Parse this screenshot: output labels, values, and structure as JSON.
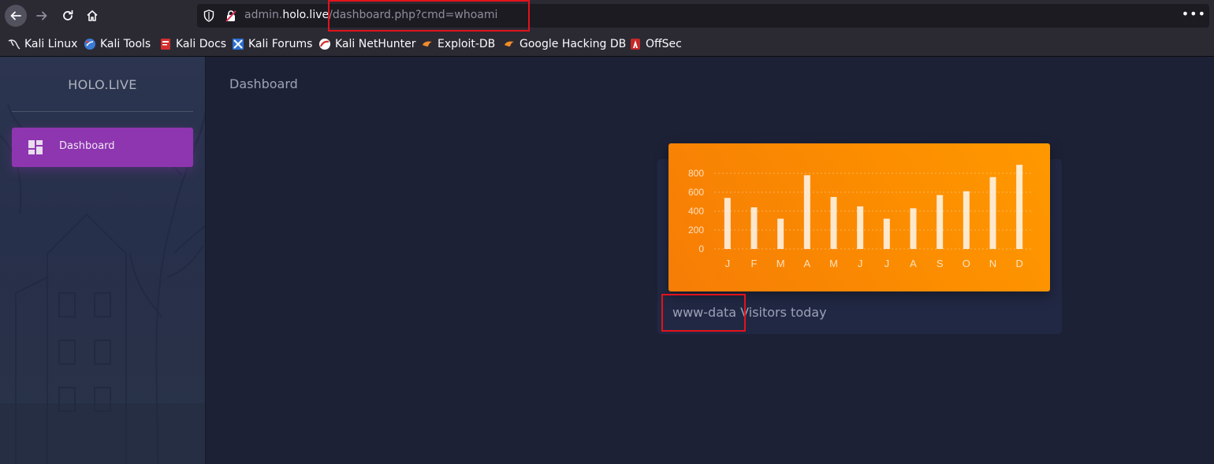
{
  "browser": {
    "url": {
      "scheme_prefix": "admin.",
      "host": "holo.live",
      "path": "/dashboard.php?cmd=whoami"
    },
    "menu_glyph": "•••",
    "bookmarks": [
      {
        "label": "Kali Linux",
        "icon": "kali-dragon-icon"
      },
      {
        "label": "Kali Tools",
        "icon": "kali-tools-icon"
      },
      {
        "label": "Kali Docs",
        "icon": "kali-docs-icon"
      },
      {
        "label": "Kali Forums",
        "icon": "kali-forums-icon"
      },
      {
        "label": "Kali NetHunter",
        "icon": "nethunter-icon"
      },
      {
        "label": "Exploit-DB",
        "icon": "exploit-db-icon"
      },
      {
        "label": "Google Hacking DB",
        "icon": "ghdb-icon"
      },
      {
        "label": "OffSec",
        "icon": "offsec-icon"
      }
    ]
  },
  "sidebar": {
    "brand": "HOLO.LIVE",
    "items": [
      {
        "label": "Dashboard",
        "icon": "dashboard-icon",
        "active": true
      }
    ]
  },
  "main": {
    "title": "Dashboard",
    "card": {
      "caption_value": "www-data",
      "caption_text": " Visitors today"
    }
  },
  "colors": {
    "accent_purple": "#8e35b0",
    "chart_orange": "#fb8c00",
    "highlight_red": "#e3121b",
    "page_bg": "#1c2136"
  },
  "chart_data": {
    "type": "bar",
    "categories": [
      "J",
      "F",
      "M",
      "A",
      "M",
      "J",
      "J",
      "A",
      "S",
      "O",
      "N",
      "D"
    ],
    "values": [
      540,
      440,
      320,
      780,
      550,
      450,
      320,
      430,
      570,
      610,
      760,
      890
    ],
    "yticks": [
      0,
      200,
      400,
      600,
      800
    ],
    "ylim": [
      0,
      900
    ],
    "grid": true,
    "title": "",
    "xlabel": "",
    "ylabel": ""
  }
}
